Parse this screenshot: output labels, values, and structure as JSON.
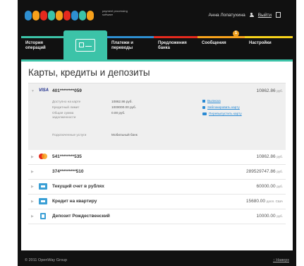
{
  "header": {
    "logo_letters": [
      {
        "color": "#2e8fd1"
      },
      {
        "color": "#f7a11b"
      },
      {
        "color": "#e52a1e"
      },
      {
        "color": "#3cc3a8"
      },
      {
        "color": "#f7a11b"
      },
      {
        "color": "#e52a1e"
      },
      {
        "color": "#2e8fd1"
      },
      {
        "color": "#3cc3a8"
      },
      {
        "color": "#f7a11b"
      }
    ],
    "logo_tagline": "payment processing software",
    "user_name": "Анна Лопатухина",
    "logout_label": "Выйти"
  },
  "nav": {
    "items": [
      {
        "label": "История операций",
        "color": "#3cc3a8"
      },
      {
        "label": "",
        "color": "#3cc3a8",
        "icon": "card-icon"
      },
      {
        "label": "Платежи и переводы",
        "color": "#2e8fd1"
      },
      {
        "label": "Предложения банка",
        "color": "#e52a1e"
      },
      {
        "label": "Сообщения",
        "color": "#f7a11b",
        "badge": "1"
      },
      {
        "label": "Настройки",
        "color": "#f7d21b"
      }
    ]
  },
  "page_title": "Карты, кредиты и депозиты",
  "expanded_card": {
    "brand": "VISA",
    "number": "401********059",
    "amount": "10862.86",
    "currency": "руб.",
    "details": [
      {
        "label": "Доступно на карте",
        "value": "10862.86 руб."
      },
      {
        "label": "Кредитный лимит",
        "value": "1000000.00 руб."
      },
      {
        "label": "Общая сумма задолженности",
        "value": "0.00 руб."
      }
    ],
    "services_label": "Подключенные услуги",
    "services_value": "Мобильный банк",
    "actions": [
      "Выписка",
      "Заблокировать карту",
      "Перевыпустить карту"
    ]
  },
  "rows": [
    {
      "name": "541********535",
      "amount": "10862.86",
      "currency": "руб.",
      "icon": "mastercard-icon"
    },
    {
      "name": "374*********510",
      "amount": "289529747.86",
      "currency": "руб.",
      "icon": ""
    },
    {
      "name": "Текущий счет в рублях",
      "amount": "60000.00",
      "currency": "руб.",
      "icon": "account-icon"
    },
    {
      "name": "Кредит на квартиру",
      "amount": "15680.00",
      "currency": "долл. США",
      "icon": "credit-icon"
    },
    {
      "name": "Депозит Рождественский",
      "amount": "10000.00",
      "currency": "руб.",
      "icon": "deposit-icon"
    }
  ],
  "footer": {
    "copyright": "© 2011 OpenWay Group",
    "up_link": "↑ Наверх"
  },
  "colors": {
    "accent": "#3cc3a8",
    "link": "#2a8ad4",
    "background": "#111111"
  }
}
